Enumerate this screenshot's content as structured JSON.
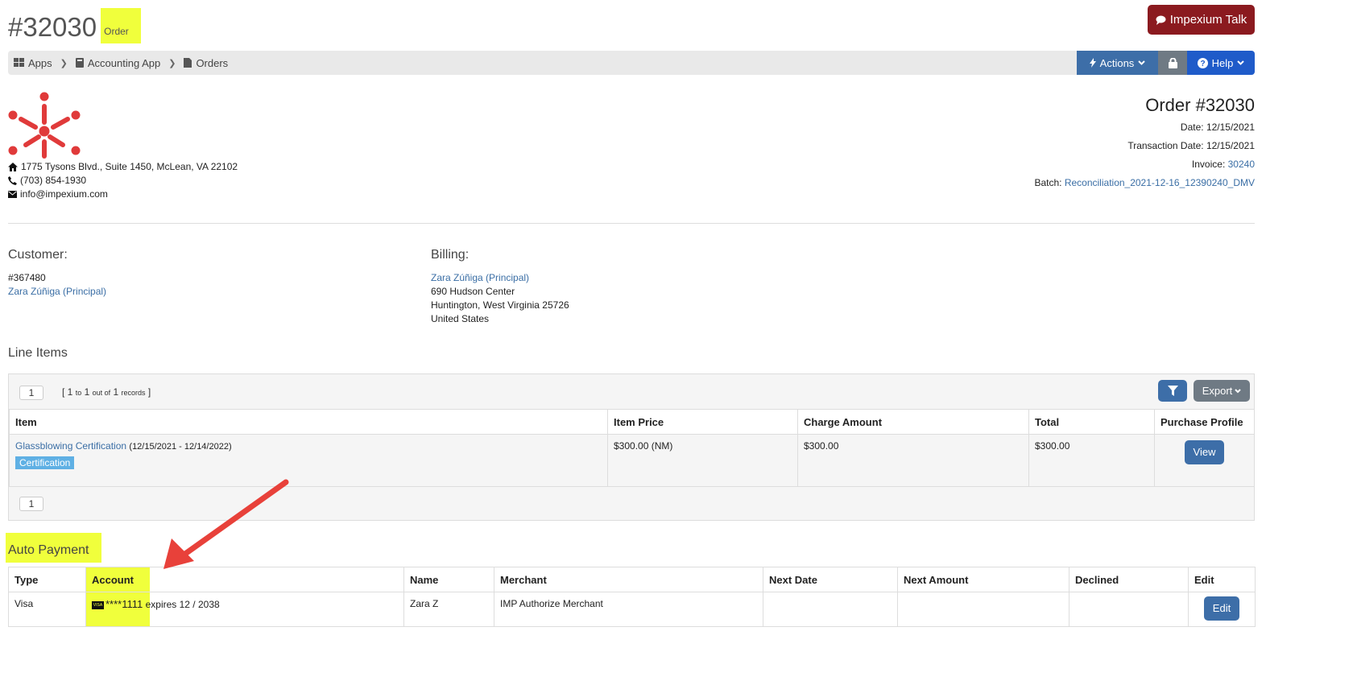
{
  "header": {
    "order_number": "#32030",
    "order_subtitle": "Order",
    "talk_button": "Impexium Talk"
  },
  "breadcrumb": [
    {
      "label": "Apps",
      "icon": "grid-icon"
    },
    {
      "label": "Accounting App",
      "icon": "book-icon"
    },
    {
      "label": "Orders",
      "icon": "file-icon"
    }
  ],
  "toolbar": {
    "actions_label": "Actions",
    "help_label": "Help"
  },
  "company": {
    "address": "1775 Tysons Blvd., Suite 1450, McLean, VA 22102",
    "phone": "(703) 854-1930",
    "email": "info@impexium.com"
  },
  "order_info": {
    "title": "Order #32030",
    "date_label": "Date:",
    "date": "12/15/2021",
    "transaction_date_label": "Transaction Date:",
    "transaction_date": "12/15/2021",
    "invoice_label": "Invoice:",
    "invoice": "30240",
    "batch_label": "Batch:",
    "batch": "Reconciliation_2021-12-16_12390240_DMV"
  },
  "customer": {
    "label": "Customer:",
    "id": "#367480",
    "name": "Zara Zúñiga (Principal)"
  },
  "billing": {
    "label": "Billing:",
    "name": "Zara Zúñiga (Principal)",
    "street": "690 Hudson Center",
    "city_state": "Huntington, West Virginia 25726",
    "country": "United States"
  },
  "line_items": {
    "label": "Line Items",
    "page": "1",
    "records": {
      "from": "1",
      "to_word": "to",
      "to": "1",
      "out_of": "out of",
      "total": "1",
      "word": "records"
    },
    "export_label": "Export",
    "columns": [
      "Item",
      "Item Price",
      "Charge Amount",
      "Total",
      "Purchase Profile"
    ],
    "rows": [
      {
        "item": "Glassblowing Certification",
        "dates": "(12/15/2021 - 12/14/2022)",
        "badge": "Certification",
        "price": "$300.00 (NM)",
        "charge": "$300.00",
        "total": "$300.00",
        "action": "View"
      }
    ]
  },
  "auto_payment": {
    "label": "Auto Payment",
    "columns": [
      "Type",
      "Account",
      "Name",
      "Merchant",
      "Next Date",
      "Next Amount",
      "Declined",
      "Edit"
    ],
    "rows": [
      {
        "type": "Visa",
        "card_brand": "VISA",
        "account": "****1111",
        "expires": "expires 12 / 2038",
        "name": "Zara Z",
        "merchant": "IMP Authorize Merchant",
        "next_date": "",
        "next_amount": "",
        "declined": "",
        "edit": "Edit"
      }
    ]
  },
  "colors": {
    "highlight": "#f0ff3c",
    "primary_button": "#3d6ea8",
    "talk_button": "#8b1a1f",
    "help_button": "#1f5bc9",
    "link": "#3a6ea5",
    "badge": "#5fb0e4",
    "arrow": "#e8413a"
  }
}
